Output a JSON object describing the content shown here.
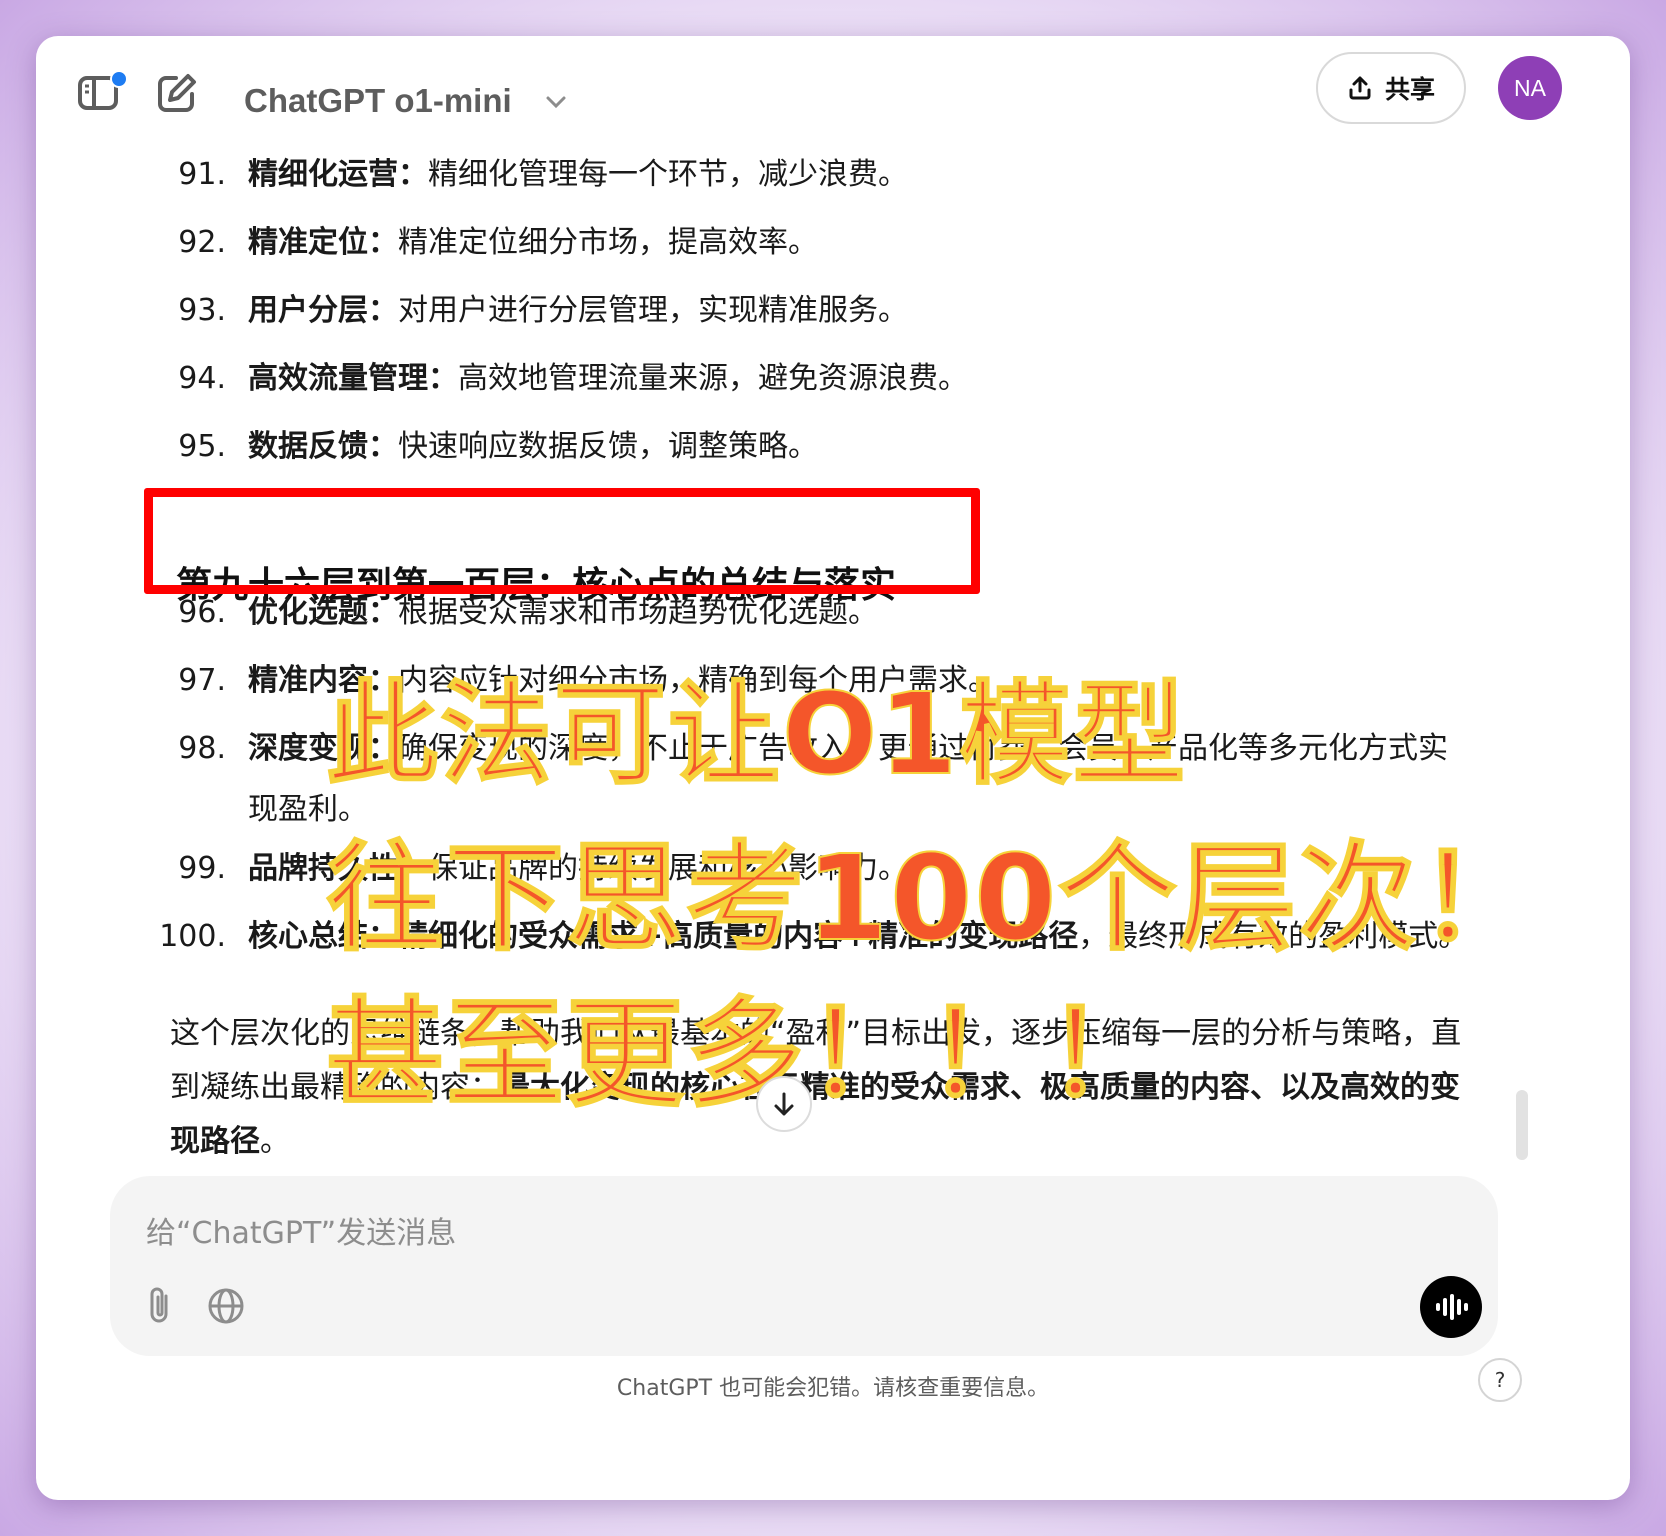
{
  "header": {
    "model_name": "ChatGPT o1-mini",
    "share_label": "共享",
    "avatar_initials": "NA"
  },
  "items": [
    {
      "num": "91.",
      "title": "精细化运营：",
      "text": "精细化管理每一个环节，减少浪费。"
    },
    {
      "num": "92.",
      "title": "精准定位：",
      "text": "精准定位细分市场，提高效率。"
    },
    {
      "num": "93.",
      "title": "用户分层：",
      "text": "对用户进行分层管理，实现精准服务。"
    },
    {
      "num": "94.",
      "title": "高效流量管理：",
      "text": "高效地管理流量来源，避免资源浪费。"
    },
    {
      "num": "95.",
      "title": "数据反馈：",
      "text": "快速响应数据反馈，调整策略。"
    },
    {
      "num": "96.",
      "title": "优化选题：",
      "text": "根据受众需求和市场趋势优化选题。"
    },
    {
      "num": "97.",
      "title": "精准内容：",
      "text": "内容应针对细分市场，精确到每个用户需求。"
    },
    {
      "num": "98.",
      "title": "深度变现：",
      "text": "确保变现的深度，不止于广告收入，更通过付费、会员、产品化等多元化方式实",
      "cont": "现盈利。"
    },
    {
      "num": "99.",
      "title": "品牌持久性：",
      "text": "保证品牌的持续发展和核心影响力。"
    },
    {
      "num": "100.",
      "title": "核心总结：",
      "text_bold": "精细化的受众需求+高质量的内容+精准的变现路径",
      "text": "，最终形成有效的盈利模式。"
    }
  ],
  "section_heading": "第九十六层到第一百层：核心点的总结与落实",
  "summary": {
    "line1": "这个层次化的思维链条，帮助我们从最基本的“盈利”目标出发，逐步压缩每一层的分析与策略，直",
    "line2_normal": "到凝练出最精确的内容：",
    "line2_bold": "最大化变现的核心在于精准的受众需求、极高质量的内容、以及高效的变",
    "line3_bold": "现路径",
    "line3_end": "。"
  },
  "overlay": {
    "line1": "此法可让O1模型",
    "line2": "往下思考100个层次！",
    "line3": "甚至更多！！！",
    "color": "#f4562a",
    "stroke": "#f6d23a"
  },
  "composer": {
    "placeholder": "给“ChatGPT”发送消息"
  },
  "footer": {
    "disclaimer": "ChatGPT 也可能会犯错。请核查重要信息。",
    "help": "?"
  },
  "colors": {
    "highlight_box": "#ff0000",
    "avatar": "#8e3fb6",
    "notification_dot": "#1e7cf2"
  },
  "icons": [
    "sidebar-toggle-icon",
    "new-chat-icon",
    "chevron-down-icon",
    "share-icon",
    "arrow-down-icon",
    "paperclip-icon",
    "globe-icon",
    "voice-icon"
  ]
}
